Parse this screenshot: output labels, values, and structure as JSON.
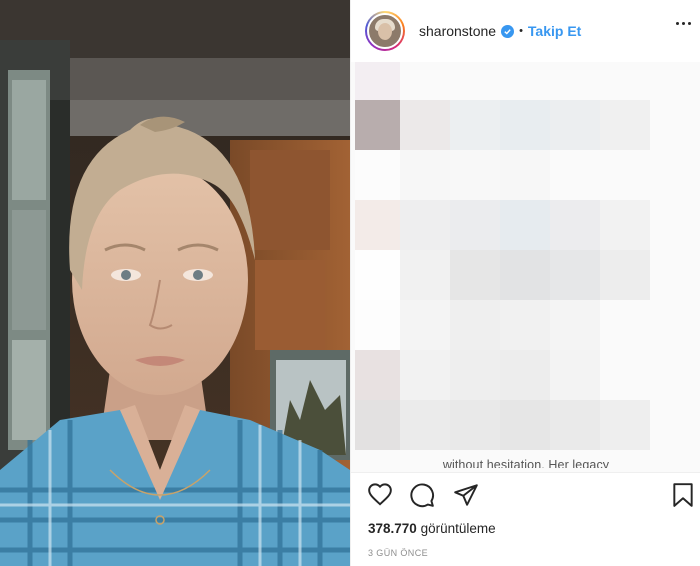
{
  "media": {
    "alt_icon": "video-selfie-photo"
  },
  "post": {
    "username": "sharonstone",
    "separator": "•",
    "follow_label": "Takip Et",
    "caption_peek": "without hesitation. Her legacy",
    "views_count": "378.770",
    "views_label": "görüntüleme",
    "time_ago": "3 GÜN ÖNCE"
  },
  "icons": {
    "like": "heart-icon",
    "comment": "comment-icon",
    "share": "share-icon",
    "save": "bookmark-icon",
    "more": "more-options-icon",
    "verified": "verified-badge-icon"
  },
  "colors": {
    "link_blue": "#3897f0",
    "text": "#262626",
    "muted": "#8e8e8e"
  }
}
